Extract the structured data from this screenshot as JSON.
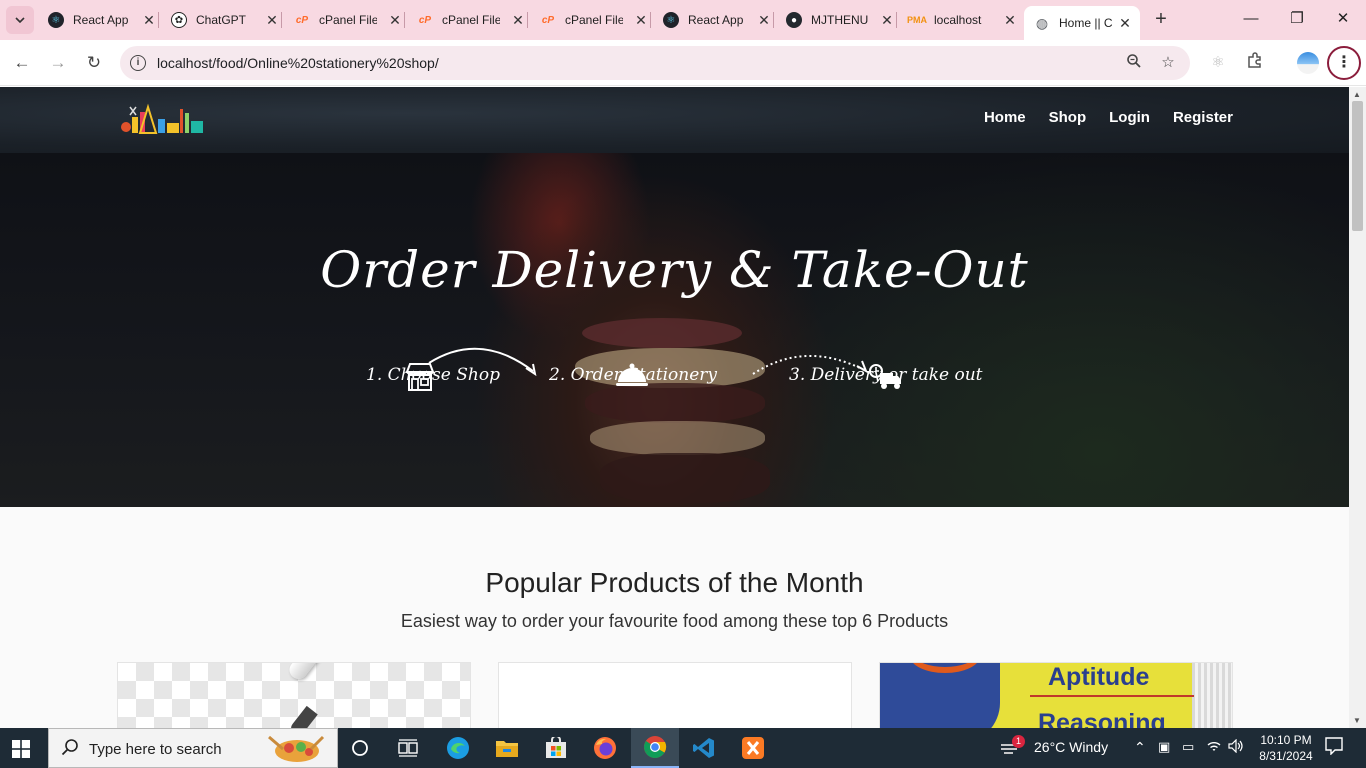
{
  "browser": {
    "tabs": [
      {
        "label": "React App",
        "favicon": "react-icon",
        "color": "#20232a"
      },
      {
        "label": "ChatGPT",
        "favicon": "chatgpt-icon",
        "color": "#202123"
      },
      {
        "label": "cPanel File",
        "favicon": "cpanel-icon",
        "color": "#ff6c2c"
      },
      {
        "label": "cPanel File",
        "favicon": "cpanel-icon",
        "color": "#ff6c2c"
      },
      {
        "label": "cPanel File",
        "favicon": "cpanel-icon",
        "color": "#ff6c2c"
      },
      {
        "label": "React App",
        "favicon": "react-icon",
        "color": "#20232a"
      },
      {
        "label": "MJTHENU",
        "favicon": "github-icon",
        "color": "#24292f"
      },
      {
        "label": "localhost",
        "favicon": "phpmyadmin-icon",
        "color": "#f29111"
      },
      {
        "label": "Home || C",
        "favicon": "globe-icon",
        "color": "#5f6368"
      }
    ],
    "url": "localhost/food/Online%20stationery%20shop/"
  },
  "site": {
    "nav": [
      "Home",
      "Shop",
      "Login",
      "Register"
    ],
    "hero": {
      "title": "Order Delivery & Take-Out",
      "steps": [
        "1. Choose Shop",
        "2. Order Stationery",
        "3. Delivery or take out"
      ]
    },
    "popular": {
      "title": "Popular Products of the Month",
      "subtitle": "Easiest way to order your favourite food among these top 6 Products"
    },
    "cards": [
      {
        "image": "pen-image"
      },
      {
        "image": "blank-image"
      },
      {
        "image": "book-image",
        "texts": [
          "Aptitude",
          "Reasoning"
        ]
      }
    ]
  },
  "taskbar": {
    "search_placeholder": "Type here to search",
    "weather": "26°C  Windy",
    "notification_count": "1",
    "time": "10:10 PM",
    "date": "8/31/2024"
  }
}
